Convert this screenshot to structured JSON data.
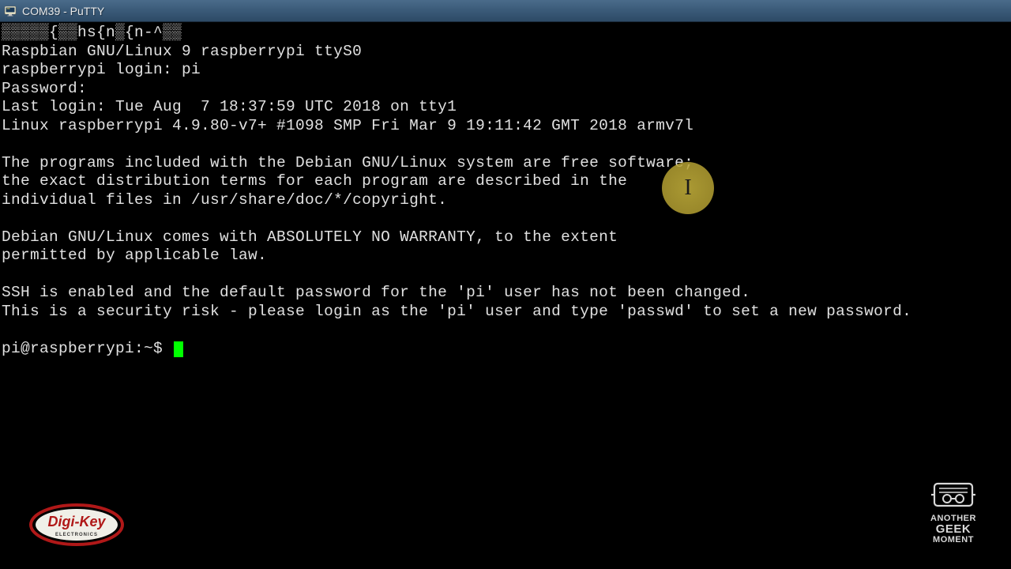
{
  "titlebar": {
    "title": "COM39 - PuTTY"
  },
  "terminal": {
    "garbage_line": "▒▒▒▒▒{▒▒hs{n▒{n-^▒▒",
    "banner": "Raspbian GNU/Linux 9 raspberrypi ttyS0",
    "login_prompt": "raspberrypi login: pi",
    "password_prompt": "Password:",
    "last_login": "Last login: Tue Aug  7 18:37:59 UTC 2018 on tty1",
    "kernel": "Linux raspberrypi 4.9.80-v7+ #1098 SMP Fri Mar 9 19:11:42 GMT 2018 armv7l",
    "motd1": "The programs included with the Debian GNU/Linux system are free software;",
    "motd2": "the exact distribution terms for each program are described in the",
    "motd3": "individual files in /usr/share/doc/*/copyright.",
    "motd4": "Debian GNU/Linux comes with ABSOLUTELY NO WARRANTY, to the extent",
    "motd5": "permitted by applicable law.",
    "ssh_warn1": "SSH is enabled and the default password for the 'pi' user has not been changed.",
    "ssh_warn2": "This is a security risk - please login as the 'pi' user and type 'passwd' to set a new password.",
    "prompt": "pi@raspberrypi:~$ "
  },
  "highlight": {
    "glyph": "I"
  },
  "watermarks": {
    "digikey_label": "Digi-Key",
    "digikey_sub": "ELECTRONICS",
    "agm_line1": "ANOTHER",
    "agm_line2": "GEEK",
    "agm_line3": "MOMENT"
  }
}
